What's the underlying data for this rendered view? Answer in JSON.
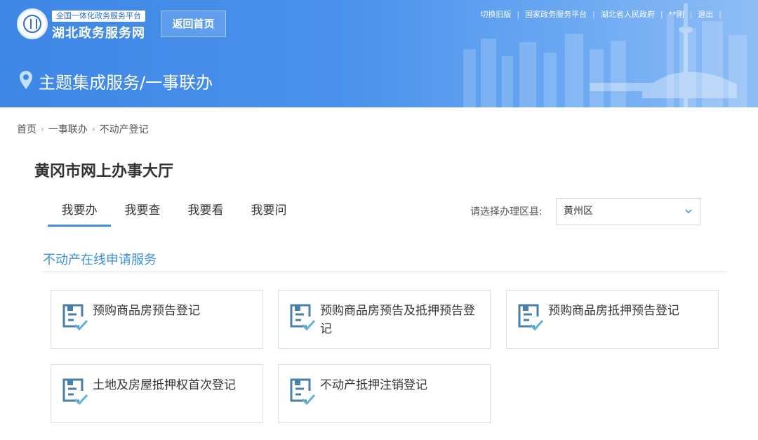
{
  "header": {
    "platform_tag": "全国一体化政务服务平台",
    "site_name": "湖北政务服务网",
    "home_button": "返回首页",
    "top_links": [
      "切换旧版",
      "国家政务服务平台",
      "湖北省人民政府",
      "**刚",
      "退出"
    ],
    "page_title": "主题集成服务/一事联办"
  },
  "breadcrumb": [
    "首页",
    "一事联办",
    "不动产登记"
  ],
  "hall_title": "黄冈市网上办事大厅",
  "tabs": [
    "我要办",
    "我要查",
    "我要看",
    "我要问"
  ],
  "county_label": "请选择办理区县:",
  "county_selected": "黄州区",
  "section_title": "不动产在线申请服务",
  "services": [
    "预购商品房预告登记",
    "预购商品房预告及抵押预告登记",
    "预购商品房抵押预告登记",
    "土地及房屋抵押权首次登记",
    "不动产抵押注销登记"
  ],
  "colors": {
    "header_blue": "#3f87e6",
    "accent": "#3d8ede",
    "icon": "#4a7fa8"
  }
}
